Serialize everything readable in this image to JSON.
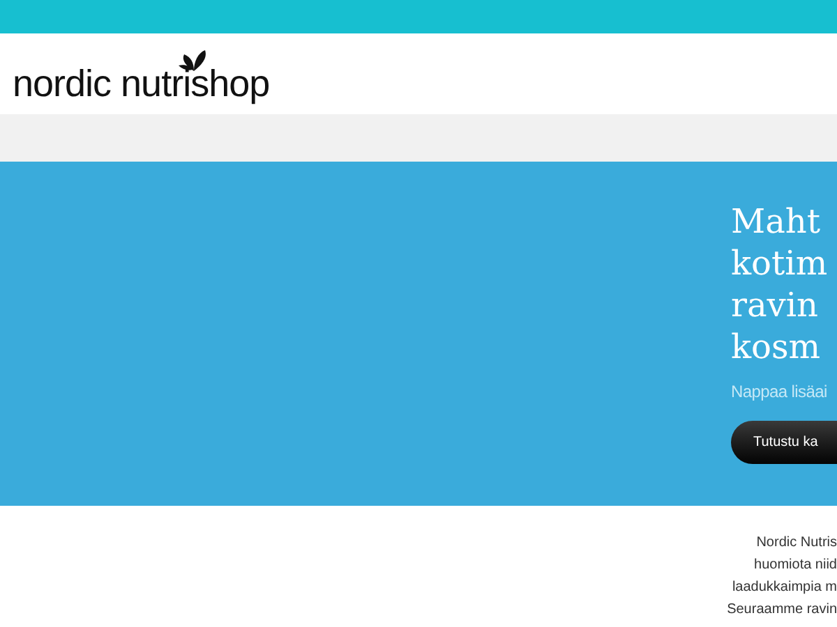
{
  "logo": {
    "text": "nordic nutrishop"
  },
  "hero": {
    "heading_lines": [
      "Maht",
      "kotim",
      "ravin",
      "kosm"
    ],
    "subtitle": "Nappaa lisäai",
    "button": "Tutustu ka"
  },
  "intro": {
    "lines": [
      "Nordic Nutris",
      "huomiota niid",
      "laadukkaimpia m",
      "Seuraamme ravin"
    ]
  }
}
